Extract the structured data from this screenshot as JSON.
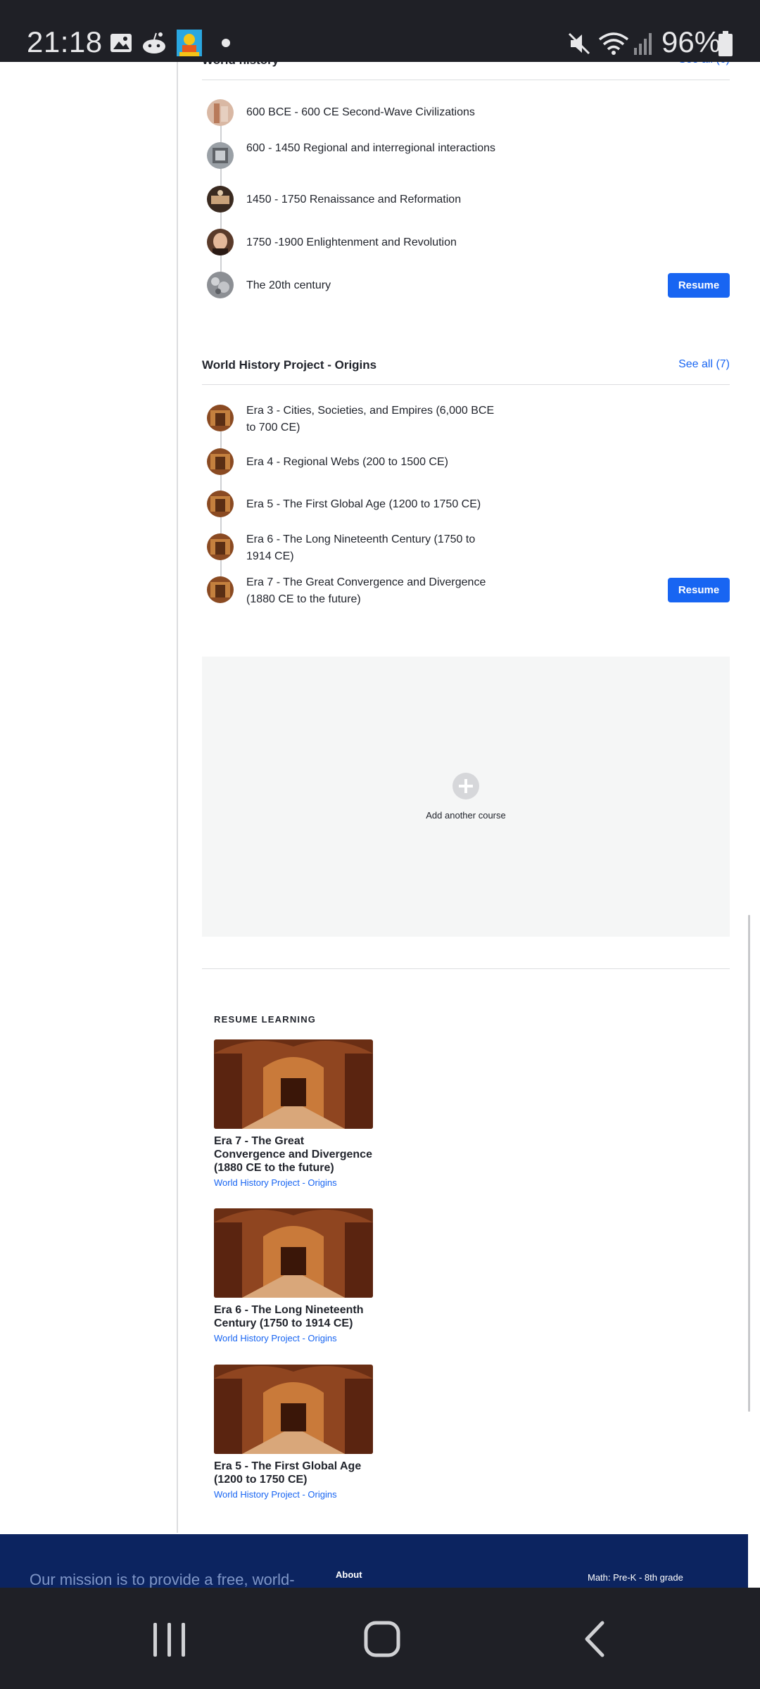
{
  "status_bar": {
    "time": "21:18",
    "battery_percent": "96%",
    "icons": [
      "image-icon",
      "reddit-icon",
      "app-icon",
      "dot-icon",
      "mute-icon",
      "wifi-icon",
      "signal-icon",
      "battery-icon"
    ]
  },
  "sections": [
    {
      "title": "World history",
      "see_all": "See all (6)",
      "units": [
        {
          "title": "600 BCE - 600 CE Second-Wave Civilizations"
        },
        {
          "title": "600 - 1450 Regional and interregional interactions"
        },
        {
          "title": "1450 - 1750 Renaissance and Reformation"
        },
        {
          "title": "1750 -1900 Enlightenment and Revolution"
        },
        {
          "title": "The 20th century",
          "resume": "Resume"
        }
      ]
    },
    {
      "title": "World History Project - Origins",
      "see_all": "See all (7)",
      "units": [
        {
          "title": "Era 3 - Cities, Societies, and Empires (6,000 BCE to 700 CE)"
        },
        {
          "title": "Era 4 - Regional Webs (200 to 1500 CE)"
        },
        {
          "title": "Era 5 - The First Global Age (1200 to 1750 CE)"
        },
        {
          "title": "Era 6 - The Long Nineteenth Century (1750 to 1914 CE)"
        },
        {
          "title": "Era 7 - The Great Convergence and Divergence (1880 CE to the future)",
          "resume": "Resume"
        }
      ]
    }
  ],
  "add_course": {
    "label": "Add another course"
  },
  "resume_learning": {
    "heading": "RESUME LEARNING",
    "cards": [
      {
        "title": "Era 7 - The Great Convergence and Divergence (1880 CE to the future)",
        "course": "World History Project - Origins"
      },
      {
        "title": "Era 6 - The Long Nineteenth Century (1750 to 1914 CE)",
        "course": "World History Project - Origins"
      },
      {
        "title": "Era 5 - The First Global Age (1200 to 1750 CE)",
        "course": "World History Project - Origins"
      }
    ]
  },
  "footer": {
    "mission": "Our mission is to provide a free, world-",
    "about": "About",
    "math": "Math: Pre-K - 8th grade"
  },
  "nav_bar": {
    "icons": [
      "recents-icon",
      "home-icon",
      "back-icon"
    ]
  },
  "colors": {
    "accent": "#1865f2",
    "footer_bg": "#0c2460",
    "system_bar": "#1f2026"
  }
}
